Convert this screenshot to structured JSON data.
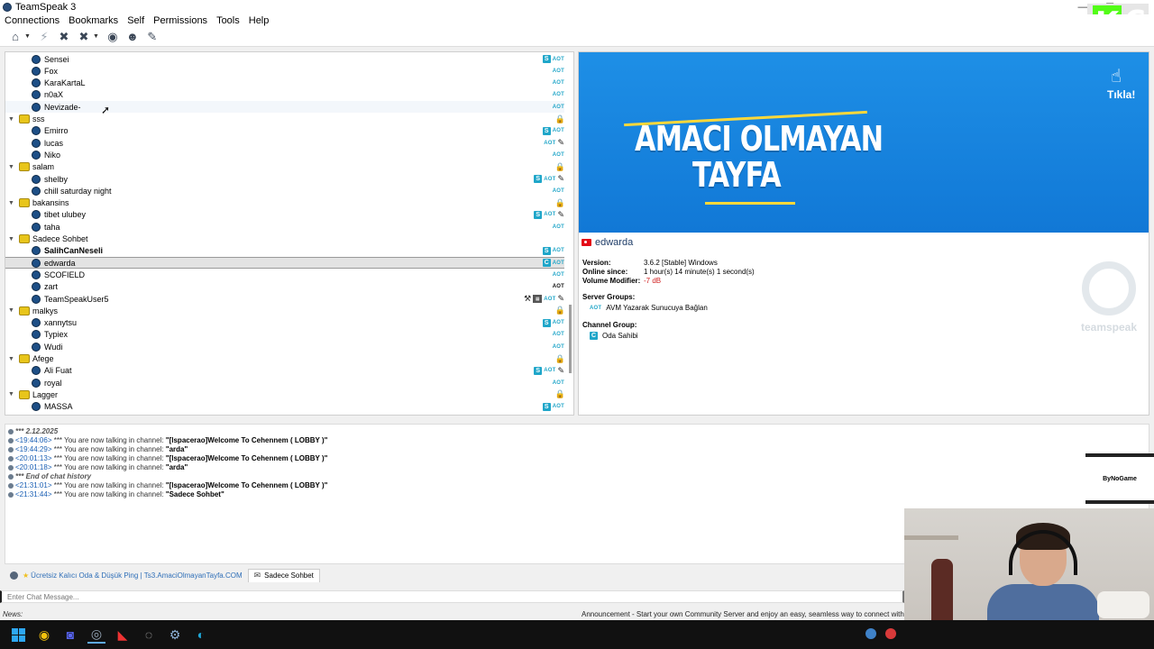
{
  "window": {
    "title": "TeamSpeak 3",
    "controls": [
      "—",
      "❐",
      "✕"
    ]
  },
  "menu": [
    "Connections",
    "Bookmarks",
    "Self",
    "Permissions",
    "Tools",
    "Help"
  ],
  "overlay": {
    "kick_six": "6",
    "kick_k": "K",
    "bynogame": "ByNoGame"
  },
  "tree": {
    "rows": [
      {
        "type": "user",
        "name": "Sensei",
        "badges": [
          "S",
          "AOT"
        ]
      },
      {
        "type": "user",
        "name": "Fox",
        "badges": [
          "AOT"
        ]
      },
      {
        "type": "user",
        "name": "KaraKartaL",
        "badges": [
          "AOT"
        ]
      },
      {
        "type": "user",
        "name": "n0aX",
        "badges": [
          "AOT"
        ]
      },
      {
        "type": "user",
        "name": "Nevizade-",
        "badges": [
          "AOT"
        ],
        "hover": true
      },
      {
        "type": "channel",
        "name": "sss",
        "badges": [
          "lock"
        ]
      },
      {
        "type": "user",
        "name": "Emirro",
        "badges": [
          "S",
          "AOT"
        ]
      },
      {
        "type": "user",
        "name": "lucas",
        "badges": [
          "AOT",
          "mic"
        ]
      },
      {
        "type": "user",
        "name": "Niko",
        "badges": [
          "AOT"
        ]
      },
      {
        "type": "channel",
        "name": "salam",
        "badges": [
          "lock"
        ]
      },
      {
        "type": "user",
        "name": "shelby",
        "badges": [
          "S",
          "AOT",
          "mic"
        ]
      },
      {
        "type": "user",
        "name": "chill saturday night",
        "badges": [
          "AOT"
        ]
      },
      {
        "type": "channel",
        "name": "bakansins",
        "badges": [
          "lock"
        ]
      },
      {
        "type": "user",
        "name": "tibet ulubey",
        "badges": [
          "S",
          "AOT",
          "mic"
        ]
      },
      {
        "type": "user",
        "name": "taha",
        "badges": [
          "AOT"
        ]
      },
      {
        "type": "channel",
        "name": "Sadece Sohbet",
        "badges": []
      },
      {
        "type": "user",
        "name": "SalihCanNeseli",
        "badges": [
          "S",
          "AOT"
        ],
        "bold": true
      },
      {
        "type": "user",
        "name": "edwarda",
        "badges": [
          "C",
          "AOT"
        ],
        "selected": true
      },
      {
        "type": "user",
        "name": "SCOFIELD",
        "badges": [
          "AOT"
        ]
      },
      {
        "type": "user",
        "name": "zart",
        "badges": [
          "AOTD"
        ]
      },
      {
        "type": "user",
        "name": "TeamSpeakUser5",
        "badges": [
          "tool",
          "img",
          "AOT",
          "mic"
        ]
      },
      {
        "type": "channel",
        "name": "malkys",
        "badges": [
          "lock"
        ]
      },
      {
        "type": "user",
        "name": "xannytsu",
        "badges": [
          "S",
          "AOT"
        ]
      },
      {
        "type": "user",
        "name": "Typiex",
        "badges": [
          "AOT"
        ]
      },
      {
        "type": "user",
        "name": "Wudi",
        "badges": [
          "AOT"
        ]
      },
      {
        "type": "channel",
        "name": "Afege",
        "badges": [
          "lock"
        ]
      },
      {
        "type": "user",
        "name": "Ali Fuat",
        "badges": [
          "S",
          "AOT",
          "mic"
        ]
      },
      {
        "type": "user",
        "name": "royal",
        "badges": [
          "AOT"
        ]
      },
      {
        "type": "channel",
        "name": "Lagger",
        "badges": [
          "lock"
        ]
      },
      {
        "type": "user",
        "name": "MASSA",
        "badges": [
          "S",
          "AOT"
        ]
      }
    ]
  },
  "banner": {
    "line1": "AMACI OLMAYAN",
    "line2": "TAYFA",
    "cta": "Tıkla!"
  },
  "client": {
    "name": "edwarda",
    "version_label": "Version:",
    "version": "3.6.2 [Stable] Windows",
    "online_label": "Online since:",
    "online": "1 hour(s) 14 minute(s) 1 second(s)",
    "volume_label": "Volume Modifier:",
    "volume": "-7 dB",
    "server_groups_label": "Server Groups:",
    "server_group_badge": "AOT",
    "server_group": "AVM Yazarak Sunucuya Bağlan",
    "channel_group_label": "Channel Group:",
    "channel_group_badge": "C",
    "channel_group": "Oda Sahibi",
    "watermark": "teamspeak"
  },
  "chat": {
    "lines": [
      {
        "kind": "sys",
        "text": "*** 2.12.2025"
      },
      {
        "kind": "msg",
        "ts": "<19:44:06>",
        "pre": " *** You are now talking in channel: ",
        "chan": "\"[lspacerao]Welcome To Cehennem ( LOBBY )\""
      },
      {
        "kind": "msg",
        "ts": "<19:44:29>",
        "pre": " *** You are now talking in channel: ",
        "chan": "\"arda\""
      },
      {
        "kind": "msg",
        "ts": "<20:01:13>",
        "pre": " *** You are now talking in channel: ",
        "chan": "\"[lspacerao]Welcome To Cehennem ( LOBBY )\""
      },
      {
        "kind": "msg",
        "ts": "<20:01:18>",
        "pre": " *** You are now talking in channel: ",
        "chan": "\"arda\""
      },
      {
        "kind": "sys",
        "text": "*** End of chat history"
      },
      {
        "kind": "msg",
        "ts": "<21:31:01>",
        "pre": " *** You are now talking in channel: ",
        "chan": "\"[lspacerao]Welcome To Cehennem ( LOBBY )\""
      },
      {
        "kind": "msg",
        "ts": "<21:31:44>",
        "pre": " *** You are now talking in channel: ",
        "chan": "\"Sadece Sohbet\""
      }
    ]
  },
  "tabs": {
    "server": "Ücretsiz Kalıcı Oda & Düşük Ping | Ts3.AmaciOlmayanTayfa.COM",
    "channel": "Sadece Sohbet"
  },
  "input": {
    "placeholder": "Enter Chat Message..."
  },
  "news": {
    "label": "News:",
    "announcement": "Announcement - Start your own Community Server and enjoy an easy, seamless way to connect with your frien"
  }
}
